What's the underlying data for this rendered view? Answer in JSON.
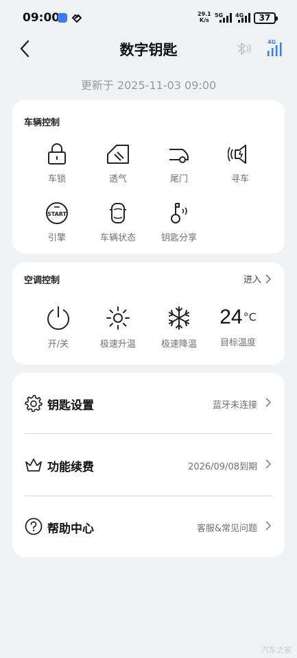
{
  "status_bar": {
    "time": "09:00",
    "net_speed": "29.1\nK/s",
    "net_speed_top": "29.1",
    "net_speed_bottom": "K/s",
    "sim1_label": "5G",
    "sim2_label": "4G",
    "battery": "37"
  },
  "header": {
    "title": "数字钥匙",
    "updated": "更新于 2025-11-03 09:00",
    "network_label": "4G"
  },
  "vehicle_control": {
    "title": "车辆控制",
    "items": [
      {
        "label": "车锁",
        "icon": "lock-icon"
      },
      {
        "label": "透气",
        "icon": "window-vent-icon"
      },
      {
        "label": "尾门",
        "icon": "tailgate-icon"
      },
      {
        "label": "寻车",
        "icon": "find-car-icon"
      },
      {
        "label": "引擎",
        "icon": "engine-start-icon"
      },
      {
        "label": "车辆状态",
        "icon": "car-status-icon"
      },
      {
        "label": "钥匙分享",
        "icon": "key-share-icon"
      }
    ]
  },
  "ac_control": {
    "title": "空调控制",
    "enter_label": "进入",
    "items": [
      {
        "label": "开/关",
        "icon": "power-icon"
      },
      {
        "label": "极速升温",
        "icon": "sun-icon"
      },
      {
        "label": "极速降温",
        "icon": "snowflake-icon"
      },
      {
        "label": "目标温度"
      }
    ],
    "target_temp": "24",
    "temp_unit": "°C"
  },
  "menu": [
    {
      "label": "钥匙设置",
      "status": "蓝牙未连接",
      "icon": "gear-icon"
    },
    {
      "label": "功能续费",
      "status": "2026/09/08到期",
      "icon": "crown-icon"
    },
    {
      "label": "帮助中心",
      "status": "客服&常见问题",
      "icon": "help-icon"
    }
  ],
  "watermark": "汽车之家",
  "colors": {
    "background": "#f1f2f4",
    "card": "#ffffff",
    "accent_blue": "#3b7cf0",
    "secondary_text": "#707070"
  }
}
